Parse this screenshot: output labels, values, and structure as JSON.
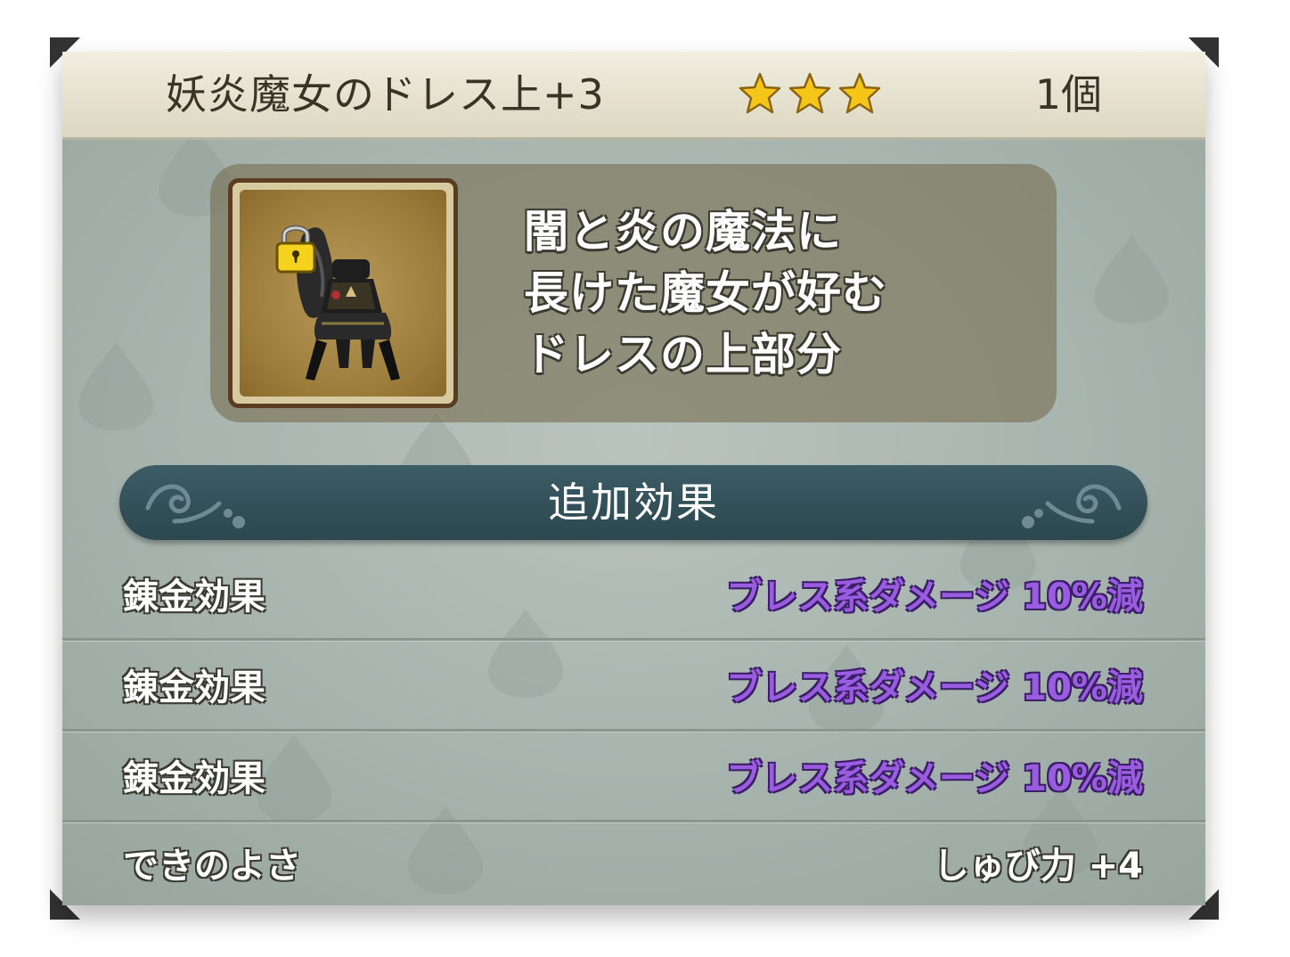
{
  "item": {
    "name": "妖炎魔女のドレス上+3",
    "star_count": 3,
    "quantity": "1個",
    "icon": "dress-top-icon",
    "locked": true,
    "description_lines": [
      "闇と炎の魔法に",
      "長けた魔女が好む",
      "ドレスの上部分"
    ]
  },
  "section": {
    "title": "追加効果"
  },
  "effects": [
    {
      "label": "錬金効果",
      "value": "ブレス系ダメージ 10%減"
    },
    {
      "label": "錬金効果",
      "value": "ブレス系ダメージ 10%減"
    },
    {
      "label": "錬金効果",
      "value": "ブレス系ダメージ 10%減"
    }
  ],
  "quality": {
    "label": "できのよさ",
    "value": "しゅび力 +4"
  },
  "colors": {
    "effect_text": "#9a5ce0",
    "banner": "#2f4c55",
    "star": "#f5c518"
  }
}
